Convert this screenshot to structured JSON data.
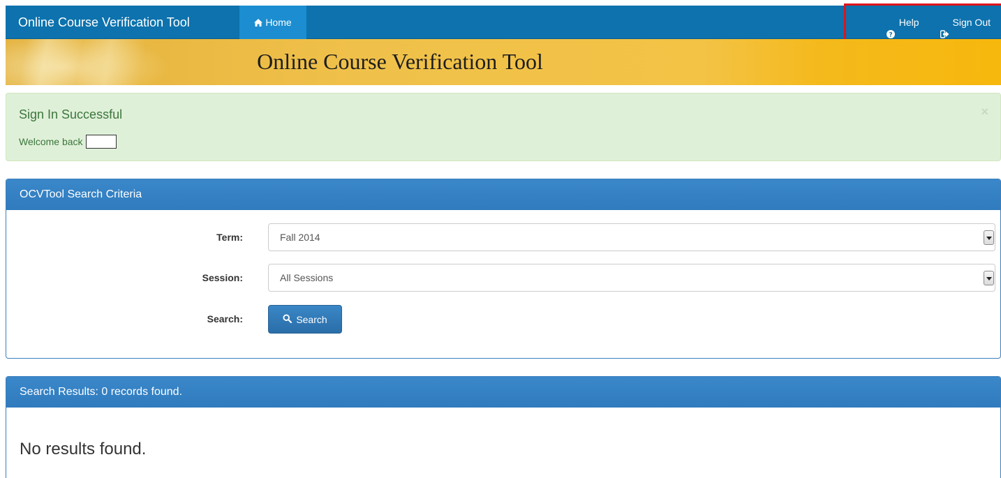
{
  "navbar": {
    "brand": "Online Course Verification Tool",
    "home_label": "Home",
    "help_label": "Help",
    "signout_label": "Sign Out",
    "home_icon": "home-icon",
    "help_icon": "question-circle-icon",
    "signout_icon": "sign-out-icon"
  },
  "banner": {
    "title": "Online Course Verification Tool"
  },
  "alert": {
    "title": "Sign In Successful",
    "text": "Welcome back",
    "close_glyph": "×"
  },
  "criteria": {
    "heading": "OCVTool Search Criteria",
    "term_label": "Term:",
    "term_value": "Fall 2014",
    "session_label": "Session:",
    "session_value": "All Sessions",
    "search_label": "Search:",
    "search_button": "Search"
  },
  "results": {
    "heading": "Search Results: 0 records found.",
    "empty_message": "No results found."
  },
  "colors": {
    "navbar": "#0d72ad",
    "nav_active": "#1b8dd0",
    "alert_bg": "#dff0d8",
    "alert_text": "#3c763d",
    "panel_heading": "#337ab7",
    "highlight": "#e0131b"
  }
}
